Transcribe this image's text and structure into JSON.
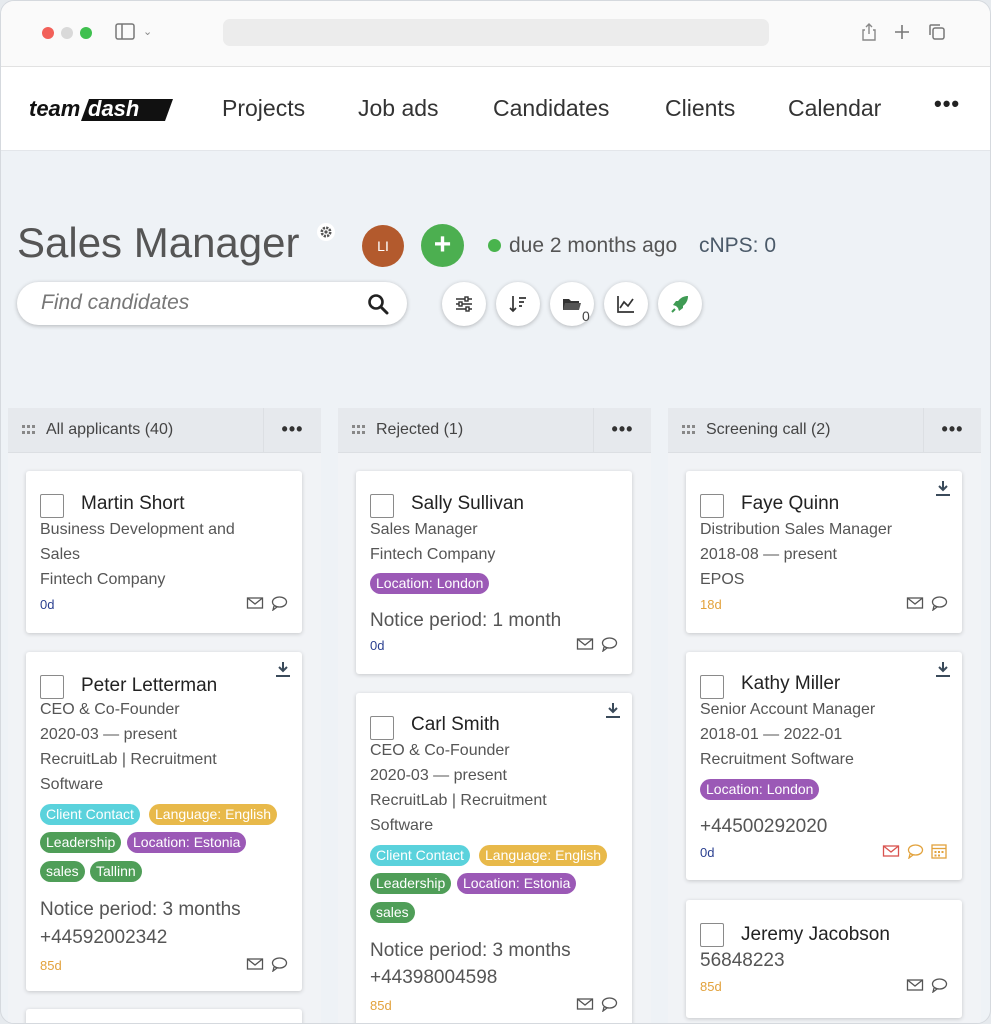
{
  "nav": {
    "logo": "teamdash",
    "items": [
      "Projects",
      "Job ads",
      "Candidates",
      "Clients",
      "Calendar"
    ],
    "more": "•••"
  },
  "header": {
    "title": "Sales Manager",
    "avatar_initials": "LI",
    "add_label": "+",
    "due": "due 2 months ago",
    "cnps": "cNPS: 0",
    "search_placeholder": "Find candidates",
    "folder_count": "0"
  },
  "columns": [
    {
      "title": "All applicants (40)",
      "more": "•••",
      "cards": [
        {
          "name": "Martin Short",
          "lines": [
            "Business Development and",
            "Sales",
            "Fintech Company"
          ],
          "age": "0d"
        },
        {
          "name": "Peter Letterman",
          "lines": [
            "CEO & Co-Founder",
            "2020-03 — present",
            "RecruitLab | Recruitment",
            "Software"
          ],
          "tags": [
            "Client Contact",
            "Language: English",
            "Leadership",
            "Location: Estonia",
            "sales",
            "Tallinn"
          ],
          "notice": "Notice period: 3 months",
          "phone": "+44592002342",
          "age": "85d"
        }
      ]
    },
    {
      "title": "Rejected (1)",
      "more": "•••",
      "cards": [
        {
          "name": "Sally Sullivan",
          "lines": [
            "Sales Manager",
            "Fintech Company"
          ],
          "tags": [
            "Location: London"
          ],
          "notice": "Notice period: 1 month",
          "age": "0d"
        },
        {
          "name": "Carl Smith",
          "lines": [
            "CEO & Co-Founder",
            "2020-03 — present",
            "RecruitLab | Recruitment",
            "Software"
          ],
          "tags": [
            "Client Contact",
            "Language: English",
            "Leadership",
            "Location: Estonia",
            "sales"
          ],
          "notice": "Notice period: 3 months",
          "phone": "+44398004598",
          "age": "85d"
        }
      ]
    },
    {
      "title": "Screening call (2)",
      "more": "•••",
      "cards": [
        {
          "name": "Faye Quinn",
          "lines": [
            "Distribution Sales Manager",
            "2018-08 — present",
            "EPOS"
          ],
          "age": "18d"
        },
        {
          "name": "Kathy Miller",
          "lines": [
            "Senior Account Manager",
            "2018-01 — 2022-01",
            "Recruitment Software"
          ],
          "tags": [
            "Location: London"
          ],
          "phone": "+44500292020",
          "age": "0d"
        },
        {
          "name": "Jeremy Jacobson",
          "phone": "56848223",
          "age": "85d"
        }
      ]
    }
  ]
}
